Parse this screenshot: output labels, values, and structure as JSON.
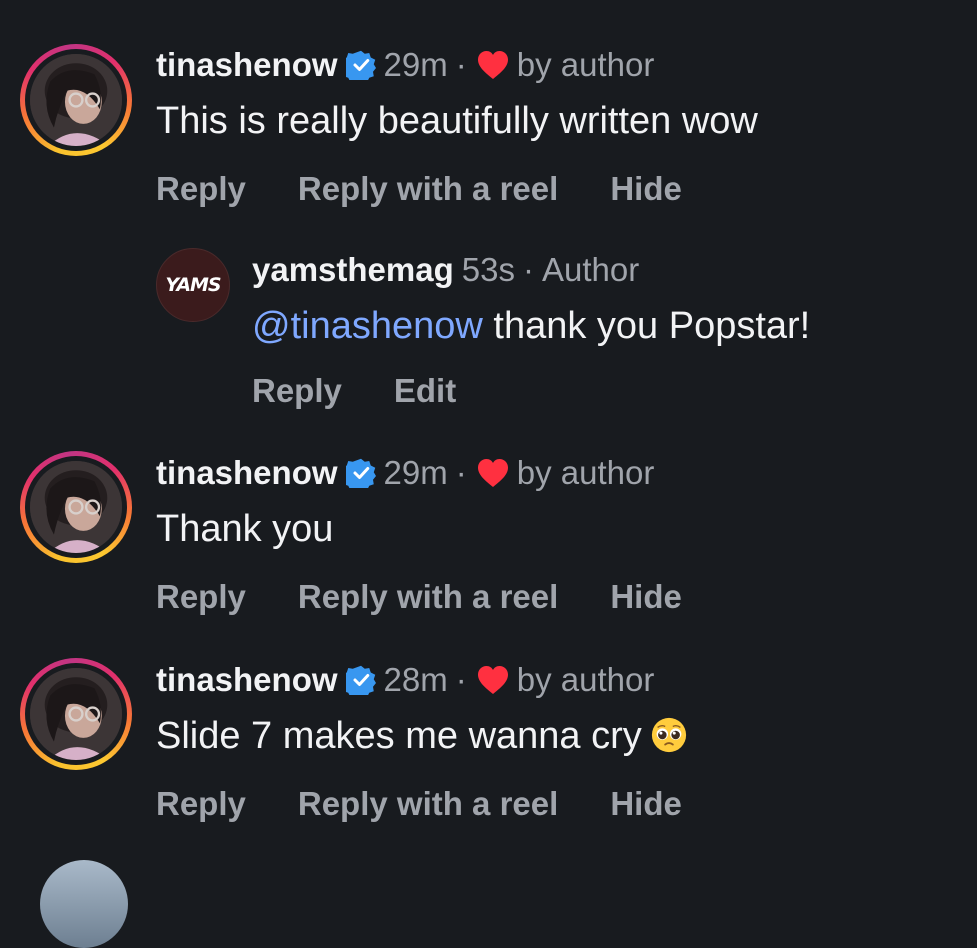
{
  "comments": [
    {
      "username": "tinashenow",
      "time": "29m",
      "separator": "·",
      "liked_by": "by author",
      "text": "This is really beautifully written wow",
      "actions": [
        "Reply",
        "Reply with a reel",
        "Hide"
      ]
    },
    {
      "username": "tinashenow",
      "time": "29m",
      "separator": "·",
      "liked_by": "by author",
      "text": "Thank you",
      "actions": [
        "Reply",
        "Reply with a reel",
        "Hide"
      ]
    },
    {
      "username": "tinashenow",
      "time": "28m",
      "separator": "·",
      "liked_by": "by author",
      "text": "Slide 7 makes me wanna cry",
      "actions": [
        "Reply",
        "Reply with a reel",
        "Hide"
      ]
    }
  ],
  "reply": {
    "avatar_text": "YAMS",
    "username": "yamsthemag",
    "time": "53s",
    "separator": "·",
    "role": "Author",
    "mention": "@tinashenow",
    "text": " thank you Popstar!",
    "actions": [
      "Reply",
      "Edit"
    ]
  },
  "icons": {
    "verified": "verified-badge-icon",
    "heart": "heart-icon",
    "emoji": "pleading-face-emoji"
  },
  "colors": {
    "background": "#181b1f",
    "verified_blue": "#3897f0",
    "heart_red": "#ff3040",
    "mention_blue": "#7fa8ff",
    "muted": "#a0a4ab"
  }
}
